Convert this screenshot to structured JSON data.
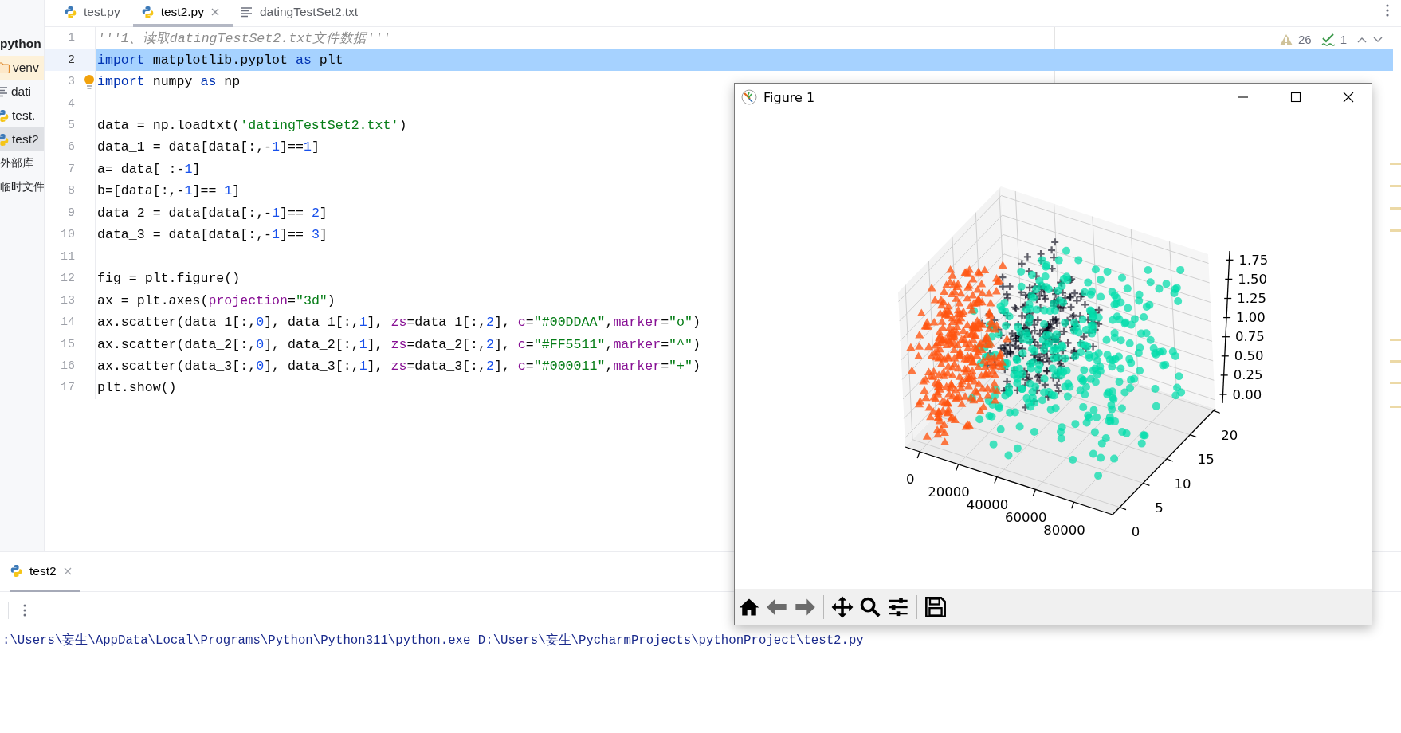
{
  "sidebar": {
    "items": [
      {
        "label": "python",
        "kind": "project",
        "selected": false
      },
      {
        "label": "venv",
        "kind": "folder",
        "selected": false
      },
      {
        "label": "dati",
        "kind": "text",
        "selected": false
      },
      {
        "label": "test.",
        "kind": "python",
        "selected": false
      },
      {
        "label": "test2",
        "kind": "python",
        "selected": true
      },
      {
        "label": "外部库",
        "kind": "plain",
        "selected": false
      },
      {
        "label": "临时文件",
        "kind": "plain",
        "selected": false
      }
    ]
  },
  "tabs": [
    {
      "label": "test.py",
      "kind": "python",
      "selected": false,
      "close_button": false
    },
    {
      "label": "test2.py",
      "kind": "python",
      "selected": true,
      "close_button": true
    },
    {
      "label": "datingTestSet2.txt",
      "kind": "text",
      "selected": false,
      "close_button": false
    }
  ],
  "inspections": {
    "warnings": "26",
    "weak_warnings": "1"
  },
  "editor": {
    "lines": [
      {
        "number": "1",
        "current": false,
        "bulb": false,
        "segments": [
          {
            "kind": "comment",
            "text": "'''1、读取datingTestSet2.txt文件数据'''"
          }
        ]
      },
      {
        "number": "2",
        "current": true,
        "bulb": false,
        "segments": [
          {
            "kind": "keyword",
            "text": "import"
          },
          {
            "kind": "plain",
            "text": " matplotlib.pyplot "
          },
          {
            "kind": "keyword",
            "text": "as"
          },
          {
            "kind": "plain",
            "text": " plt"
          }
        ]
      },
      {
        "number": "3",
        "current": false,
        "bulb": true,
        "segments": [
          {
            "kind": "keyword",
            "text": "import"
          },
          {
            "kind": "plain",
            "text": " numpy "
          },
          {
            "kind": "keyword",
            "text": "as"
          },
          {
            "kind": "plain",
            "text": " np"
          }
        ]
      },
      {
        "number": "4",
        "current": false,
        "bulb": false
      },
      {
        "number": "5",
        "current": false,
        "bulb": false,
        "segments": [
          {
            "kind": "plain",
            "text": "data = np.loadtxt("
          },
          {
            "kind": "string",
            "text": "'datingTestSet2.txt'"
          },
          {
            "kind": "plain",
            "text": ")"
          }
        ]
      },
      {
        "number": "6",
        "current": false,
        "bulb": false,
        "segments": [
          {
            "kind": "plain",
            "text": "data_1 = data[data[:,-"
          },
          {
            "kind": "number",
            "text": "1"
          },
          {
            "kind": "plain",
            "text": "]=="
          },
          {
            "kind": "number",
            "text": "1"
          },
          {
            "kind": "plain",
            "text": "]"
          }
        ]
      },
      {
        "number": "7",
        "current": false,
        "bulb": false,
        "segments": [
          {
            "kind": "plain",
            "text": "a= data[ :-"
          },
          {
            "kind": "number",
            "text": "1"
          },
          {
            "kind": "plain",
            "text": "]"
          }
        ]
      },
      {
        "number": "8",
        "current": false,
        "bulb": false,
        "segments": [
          {
            "kind": "plain",
            "text": "b=[data[:,-"
          },
          {
            "kind": "number",
            "text": "1"
          },
          {
            "kind": "plain",
            "text": "]== "
          },
          {
            "kind": "number",
            "text": "1"
          },
          {
            "kind": "plain",
            "text": "]"
          }
        ]
      },
      {
        "number": "9",
        "current": false,
        "bulb": false,
        "segments": [
          {
            "kind": "plain",
            "text": "data_2 = data[data[:,-"
          },
          {
            "kind": "number",
            "text": "1"
          },
          {
            "kind": "plain",
            "text": "]== "
          },
          {
            "kind": "number",
            "text": "2"
          },
          {
            "kind": "plain",
            "text": "]"
          }
        ]
      },
      {
        "number": "10",
        "current": false,
        "bulb": false,
        "segments": [
          {
            "kind": "plain",
            "text": "data_3 = data[data[:,-"
          },
          {
            "kind": "number",
            "text": "1"
          },
          {
            "kind": "plain",
            "text": "]== "
          },
          {
            "kind": "number",
            "text": "3"
          },
          {
            "kind": "plain",
            "text": "]"
          }
        ]
      },
      {
        "number": "11",
        "current": false,
        "bulb": false
      },
      {
        "number": "12",
        "current": false,
        "bulb": false,
        "segments": [
          {
            "kind": "plain",
            "text": "fig = plt.figure()"
          }
        ]
      },
      {
        "number": "13",
        "current": false,
        "bulb": false,
        "segments": [
          {
            "kind": "plain",
            "text": "ax = plt.axes("
          },
          {
            "kind": "param",
            "text": "projection"
          },
          {
            "kind": "plain",
            "text": "="
          },
          {
            "kind": "string",
            "text": "\"3d\""
          },
          {
            "kind": "plain",
            "text": ")"
          }
        ]
      },
      {
        "number": "14",
        "current": false,
        "bulb": false,
        "segments": [
          {
            "kind": "plain",
            "text": "ax.scatter(data_1[:,"
          },
          {
            "kind": "number",
            "text": "0"
          },
          {
            "kind": "plain",
            "text": "], data_1[:,"
          },
          {
            "kind": "number",
            "text": "1"
          },
          {
            "kind": "plain",
            "text": "], "
          },
          {
            "kind": "param",
            "text": "zs"
          },
          {
            "kind": "plain",
            "text": "=data_1[:,"
          },
          {
            "kind": "number",
            "text": "2"
          },
          {
            "kind": "plain",
            "text": "], "
          },
          {
            "kind": "param",
            "text": "c"
          },
          {
            "kind": "plain",
            "text": "="
          },
          {
            "kind": "string",
            "text": "\"#00DDAA\""
          },
          {
            "kind": "plain",
            "text": ","
          },
          {
            "kind": "param",
            "text": "marker"
          },
          {
            "kind": "plain",
            "text": "="
          },
          {
            "kind": "string",
            "text": "\"o\""
          },
          {
            "kind": "plain",
            "text": ")"
          }
        ]
      },
      {
        "number": "15",
        "current": false,
        "bulb": false,
        "segments": [
          {
            "kind": "plain",
            "text": "ax.scatter(data_2[:,"
          },
          {
            "kind": "number",
            "text": "0"
          },
          {
            "kind": "plain",
            "text": "], data_2[:,"
          },
          {
            "kind": "number",
            "text": "1"
          },
          {
            "kind": "plain",
            "text": "], "
          },
          {
            "kind": "param",
            "text": "zs"
          },
          {
            "kind": "plain",
            "text": "=data_2[:,"
          },
          {
            "kind": "number",
            "text": "2"
          },
          {
            "kind": "plain",
            "text": "], "
          },
          {
            "kind": "param",
            "text": "c"
          },
          {
            "kind": "plain",
            "text": "="
          },
          {
            "kind": "string",
            "text": "\"#FF5511\""
          },
          {
            "kind": "plain",
            "text": ","
          },
          {
            "kind": "param",
            "text": "marker"
          },
          {
            "kind": "plain",
            "text": "="
          },
          {
            "kind": "string",
            "text": "\"^\""
          },
          {
            "kind": "plain",
            "text": ")"
          }
        ]
      },
      {
        "number": "16",
        "current": false,
        "bulb": false,
        "segments": [
          {
            "kind": "plain",
            "text": "ax.scatter(data_3[:,"
          },
          {
            "kind": "number",
            "text": "0"
          },
          {
            "kind": "plain",
            "text": "], data_3[:,"
          },
          {
            "kind": "number",
            "text": "1"
          },
          {
            "kind": "plain",
            "text": "], "
          },
          {
            "kind": "param",
            "text": "zs"
          },
          {
            "kind": "plain",
            "text": "=data_3[:,"
          },
          {
            "kind": "number",
            "text": "2"
          },
          {
            "kind": "plain",
            "text": "], "
          },
          {
            "kind": "param",
            "text": "c"
          },
          {
            "kind": "plain",
            "text": "="
          },
          {
            "kind": "string",
            "text": "\"#000011\""
          },
          {
            "kind": "plain",
            "text": ","
          },
          {
            "kind": "param",
            "text": "marker"
          },
          {
            "kind": "plain",
            "text": "="
          },
          {
            "kind": "string",
            "text": "\"+\""
          },
          {
            "kind": "plain",
            "text": ")"
          }
        ]
      },
      {
        "number": "17",
        "current": false,
        "bulb": false,
        "segments": [
          {
            "kind": "plain",
            "text": "plt.show()"
          }
        ]
      }
    ]
  },
  "run_panel": {
    "tabs": [
      {
        "label": "test2",
        "selected": true,
        "close_button": true
      }
    ],
    "console": [
      ":\\Users\\妄生\\AppData\\Local\\Programs\\Python\\Python311\\python.exe D:\\Users\\妄生\\PycharmProjects\\pythonProject\\test2.py"
    ]
  },
  "figure_window": {
    "title": "Figure 1",
    "plot": {
      "x_ticks": [
        "0",
        "20000",
        "40000",
        "60000",
        "80000"
      ],
      "y_ticks": [
        "0",
        "5",
        "10",
        "15",
        "20"
      ],
      "z_ticks": [
        "1.75",
        "1.50",
        "1.25",
        "1.00",
        "0.75",
        "0.50",
        "0.25",
        "0.00"
      ]
    }
  }
}
